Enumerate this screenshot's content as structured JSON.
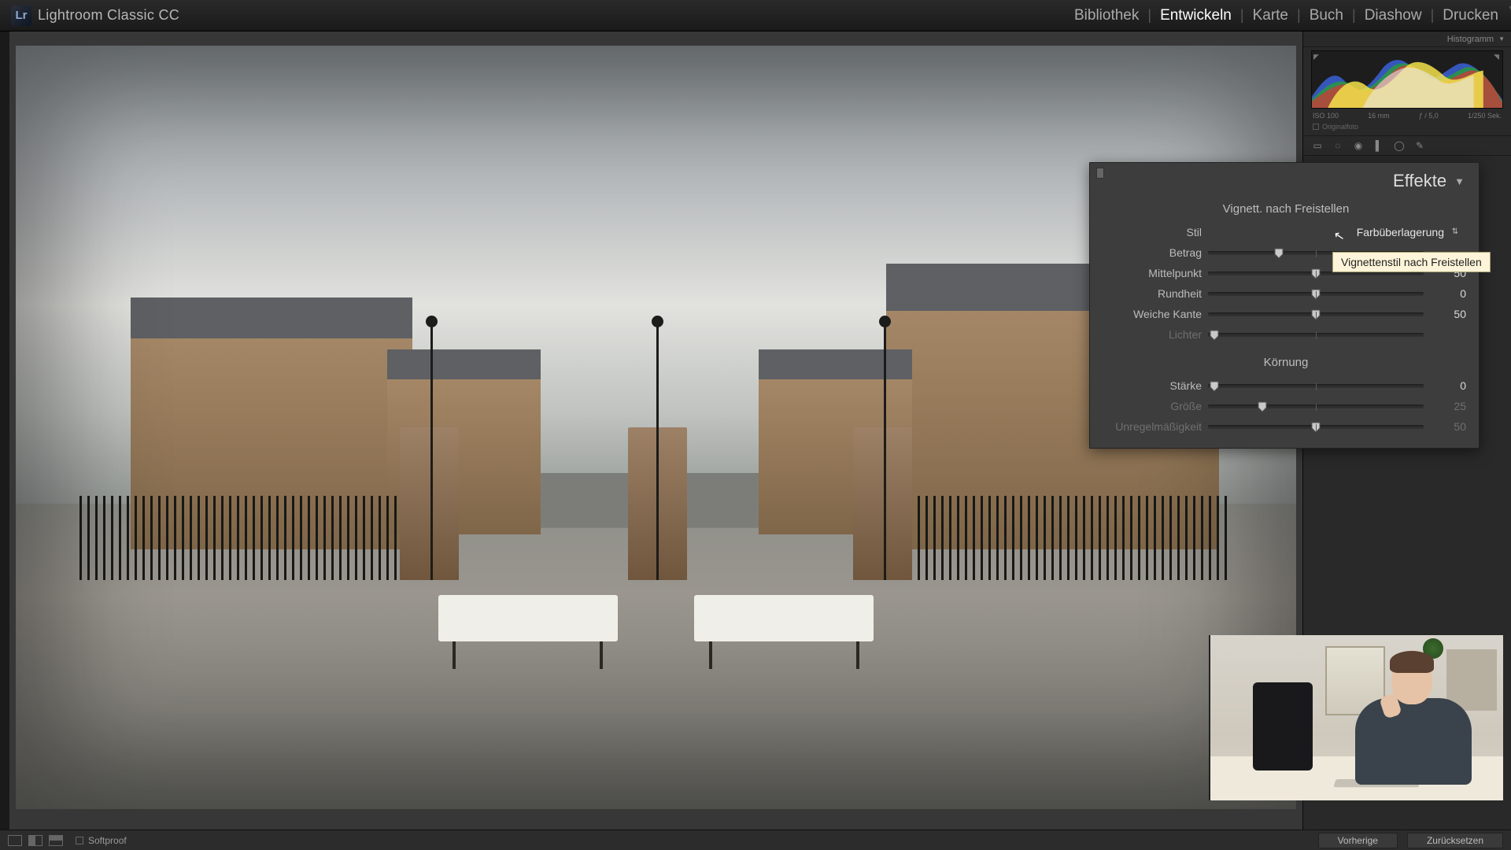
{
  "app": {
    "logo_abbrev": "Lr",
    "title": "Lightroom Classic CC"
  },
  "modules": {
    "items": [
      "Bibliothek",
      "Entwickeln",
      "Karte",
      "Buch",
      "Diashow",
      "Drucken"
    ],
    "active_index": 1
  },
  "histogram": {
    "header": "Histogramm",
    "meta": {
      "iso": "ISO 100",
      "focal": "16 mm",
      "aperture": "ƒ / 5,0",
      "shutter": "1/250 Sek."
    },
    "original_label": "Originalfoto"
  },
  "effects_panel": {
    "title": "Effekte",
    "vignette": {
      "section_title": "Vignett. nach Freistellen",
      "style_label": "Stil",
      "style_value": "Farbüberlagerung",
      "sliders": [
        {
          "label": "Betrag",
          "value": "",
          "pos": 33,
          "dim": false
        },
        {
          "label": "Mittelpunkt",
          "value": "50",
          "pos": 50,
          "dim": false
        },
        {
          "label": "Rundheit",
          "value": "0",
          "pos": 50,
          "dim": false
        },
        {
          "label": "Weiche Kante",
          "value": "50",
          "pos": 50,
          "dim": false
        },
        {
          "label": "Lichter",
          "value": "",
          "pos": 3,
          "dim": true
        }
      ]
    },
    "grain": {
      "section_title": "Körnung",
      "sliders": [
        {
          "label": "Stärke",
          "value": "0",
          "pos": 3,
          "dim": false
        },
        {
          "label": "Größe",
          "value": "25",
          "pos": 25,
          "dim": true
        },
        {
          "label": "Unregelmäßigkeit",
          "value": "50",
          "pos": 50,
          "dim": true
        }
      ]
    }
  },
  "tooltip": {
    "text": "Vignettenstil nach Freistellen"
  },
  "bottom": {
    "softproof": "Softproof",
    "prev": "Vorherige",
    "reset": "Zurücksetzen"
  }
}
